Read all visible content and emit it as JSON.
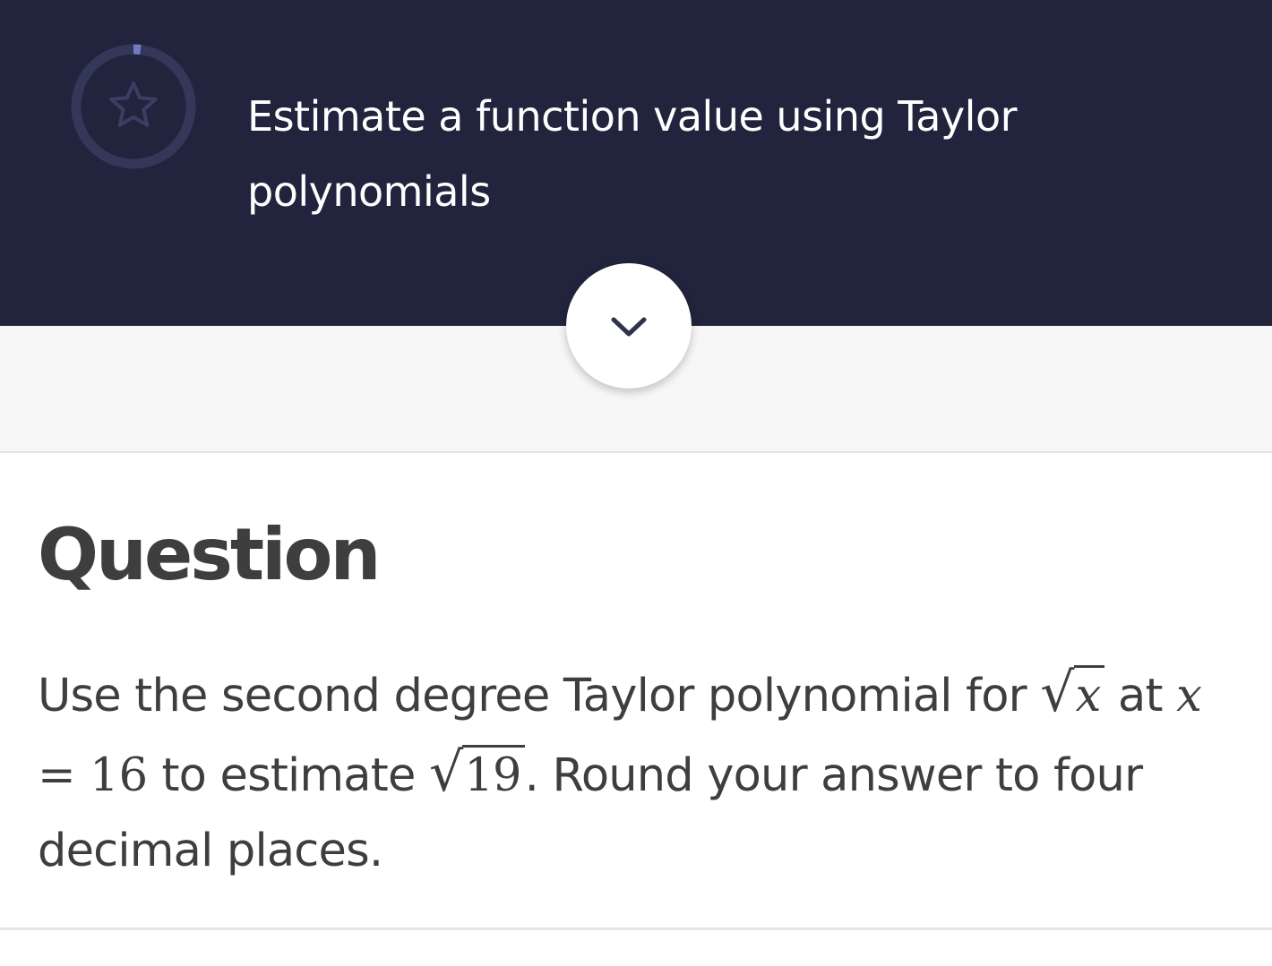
{
  "header": {
    "title": "Estimate a function value using Taylor polynomials",
    "progress_ring_icon": "star-icon",
    "progress_fraction": 0.02,
    "background_color": "#22243d",
    "accent_color": "#7277c8"
  },
  "expand_button": {
    "icon": "chevron-down-icon"
  },
  "question": {
    "heading": "Question",
    "body": {
      "part1": "Use the second degree Taylor polynomial for",
      "sqrt1_radicand": "x",
      "part2": "at",
      "eq_var": "x",
      "eq_sign": "=",
      "eq_value": "16",
      "part3": "to estimate",
      "sqrt2_radicand": "19",
      "part4": ". Round your answer to four decimal places."
    }
  }
}
